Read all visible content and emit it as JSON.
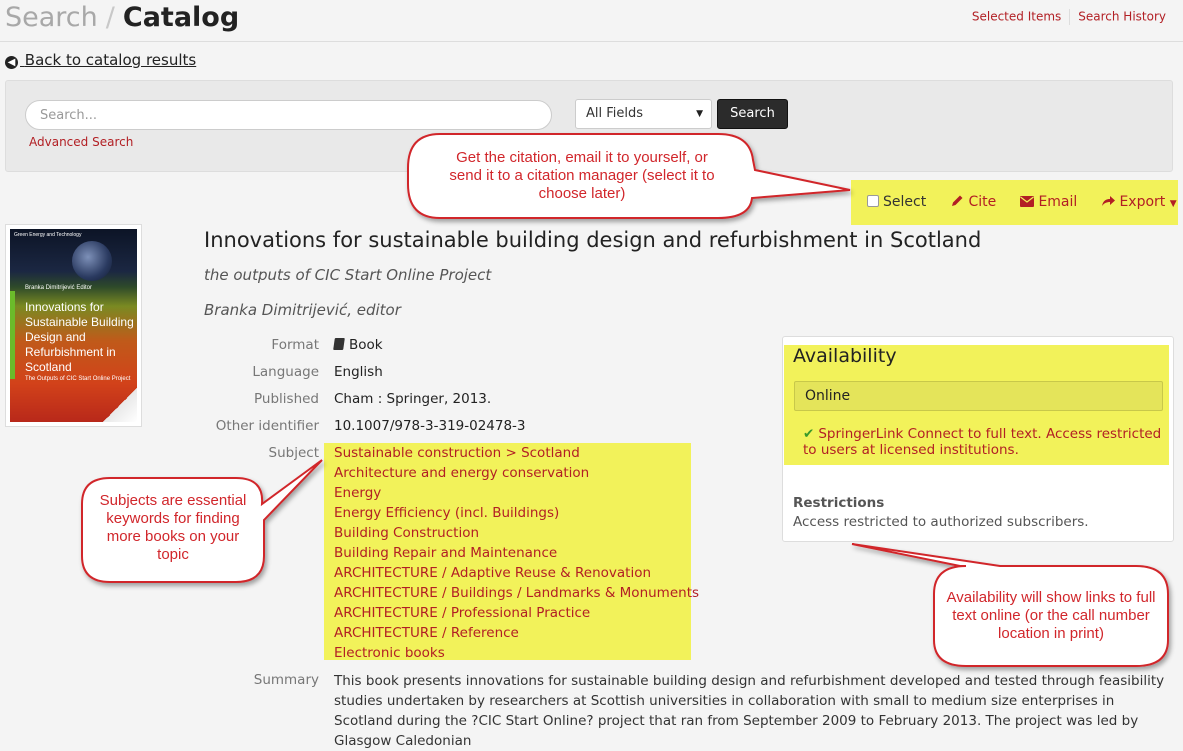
{
  "header": {
    "breadcrumb_parent": "Search",
    "breadcrumb_separator": "/",
    "title": "Catalog",
    "links": [
      "Selected Items",
      "Search History"
    ]
  },
  "back_link": "Back to catalog results",
  "search": {
    "placeholder": "Search...",
    "field_select": "All Fields",
    "button": "Search",
    "advanced": "Advanced Search"
  },
  "toolbar": {
    "select": "Select",
    "cite": "Cite",
    "email": "Email",
    "export": "Export"
  },
  "cover": {
    "series": "Green Energy and Technology",
    "editor": "Branka Dimitrijević  Editor",
    "title": "Innovations for Sustainable Building Design and Refurbishment in Scotland",
    "subtitle": "The Outputs of CIC Start Online Project"
  },
  "record": {
    "title": "Innovations for sustainable building design and refurbishment in Scotland",
    "subtitle": "the outputs of CIC Start Online Project",
    "author": "Branka Dimitrijević, editor",
    "details": [
      {
        "label": "Format",
        "value": "Book"
      },
      {
        "label": "Language",
        "value": "English"
      },
      {
        "label": "Published",
        "value": "Cham : Springer, 2013."
      },
      {
        "label": "Other identifier",
        "value": "10.1007/978-3-319-02478-3"
      }
    ],
    "subject_label": "Subject",
    "subjects": [
      "Sustainable construction > Scotland",
      "Architecture and energy conservation",
      "Energy",
      "Energy Efficiency (incl. Buildings)",
      "Building Construction",
      "Building Repair and Maintenance",
      "ARCHITECTURE / Adaptive Reuse & Renovation",
      "ARCHITECTURE / Buildings / Landmarks & Monuments",
      "ARCHITECTURE / Professional Practice",
      "ARCHITECTURE / Reference",
      "Electronic books"
    ],
    "summary_label": "Summary",
    "summary": "This book presents innovations for sustainable building design and refurbishment developed and tested through feasibility studies undertaken by researchers at Scottish universities in collaboration with small to medium size enterprises in Scotland during the ?CIC Start Online? project that ran from September 2009 to February 2013. The project was led by Glasgow Caledonian"
  },
  "availability": {
    "heading": "Availability",
    "online": "Online",
    "link": "SpringerLink Connect to full text. Access restricted to users at licensed institutions.",
    "restrictions_heading": "Restrictions",
    "restrictions_text": "Access restricted to authorized subscribers."
  },
  "callouts": {
    "citation": "Get the citation, email it to yourself, or send it to a citation manager (select it to choose later)",
    "subjects": "Subjects are essential keywords for finding more books on your topic",
    "availability": "Availability will show links to full text online (or the call number location in print)"
  },
  "colors": {
    "accent": "#b21f24",
    "highlight": "#f2f25a",
    "callout": "#d1262b"
  }
}
